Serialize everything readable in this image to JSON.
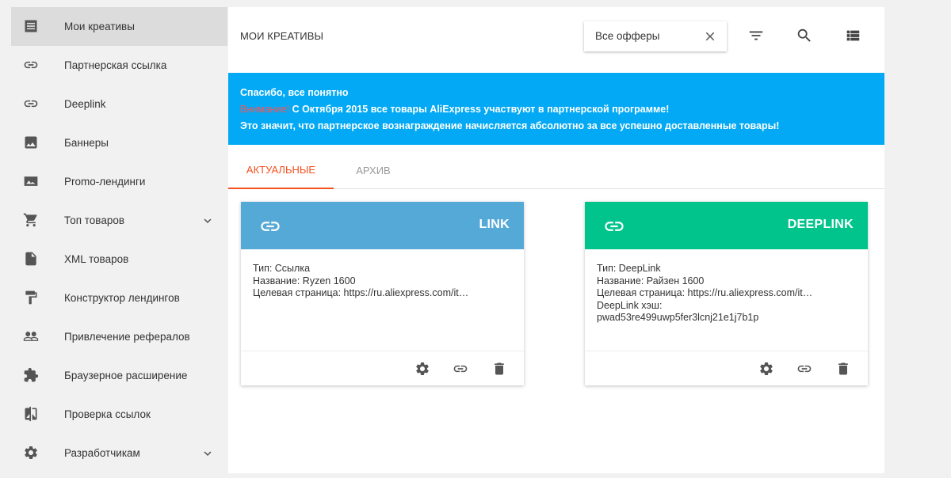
{
  "sidebar": {
    "items": [
      {
        "label": "Мои креативы",
        "icon": "list-icon"
      },
      {
        "label": "Партнерская ссылка",
        "icon": "link-icon"
      },
      {
        "label": "Deeplink",
        "icon": "link-icon"
      },
      {
        "label": "Баннеры",
        "icon": "image-icon"
      },
      {
        "label": "Promo-лендинги",
        "icon": "image-icon"
      },
      {
        "label": "Топ товаров",
        "icon": "cart-icon"
      },
      {
        "label": "XML товаров",
        "icon": "file-icon"
      },
      {
        "label": "Конструктор лендингов",
        "icon": "paint-roller-icon"
      },
      {
        "label": "Привлечение рефералов",
        "icon": "people-icon"
      },
      {
        "label": "Браузерное расширение",
        "icon": "extension-icon"
      },
      {
        "label": "Проверка ссылок",
        "icon": "compare-icon"
      },
      {
        "label": "Разработчикам",
        "icon": "gear-icon"
      }
    ]
  },
  "header": {
    "title": "МОИ КРЕАТИВЫ",
    "offer_select": "Все офферы"
  },
  "notice": {
    "line1": "Спасибо, все понятно",
    "warning": "Внимание!",
    "line2": " С Октября 2015 все товары AliExpress участвуют в партнерской программе!",
    "line3": "Это значит, что партнерское вознаграждение начисляется абсолютно за все успешно доставленные товары!"
  },
  "tabs": [
    {
      "label": "АКТУАЛЬНЫЕ"
    },
    {
      "label": "АРХИВ"
    }
  ],
  "cards": [
    {
      "type": "LINK",
      "color": "#55a9d6",
      "lines": [
        "Тип: Ссылка",
        "Название: Ryzen 1600",
        "Целевая страница: https://ru.aliexpress.com/it…"
      ]
    },
    {
      "type": "DEEPLINK",
      "color": "#00c48c",
      "lines": [
        "Тип: DeepLink",
        "Название: Райзен 1600",
        "Целевая страница: https://ru.aliexpress.com/it…",
        "DeepLink хэш:",
        "pwad53re499uwp5fer3lcnj21e1j7b1p"
      ]
    }
  ],
  "colors": {
    "notice_bg": "#03a9f4",
    "warning": "#ff5252",
    "tab_active": "#f4511e"
  }
}
